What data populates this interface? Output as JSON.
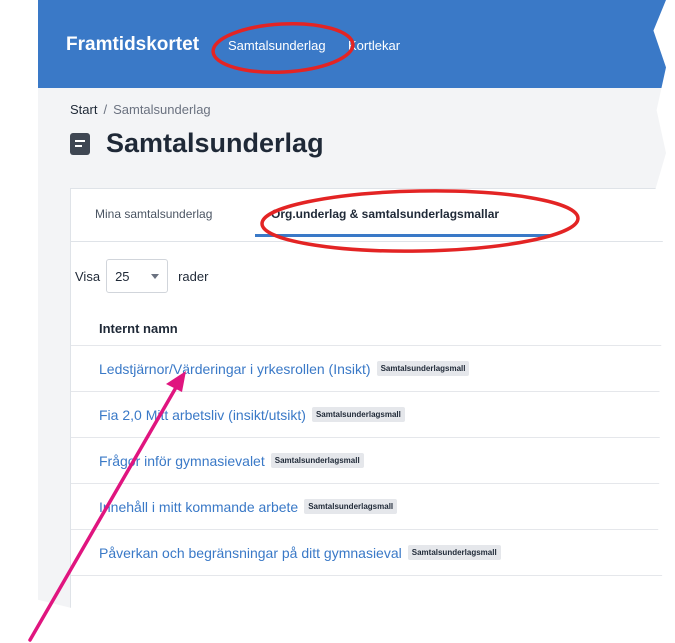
{
  "header": {
    "brand": "Framtidskortet",
    "nav": [
      "Samtalsunderlag",
      "Kortlekar"
    ]
  },
  "breadcrumb": {
    "start": "Start",
    "separator": "/",
    "current": "Samtalsunderlag"
  },
  "page_title": "Samtalsunderlag",
  "tabs": [
    {
      "label": "Mina samtalsunderlag"
    },
    {
      "label": "Org.underlag & samtalsunderlagsmallar"
    }
  ],
  "page_size": {
    "show_label": "Visa",
    "selected": "25",
    "suffix_label": "rader"
  },
  "table": {
    "column_header": "Internt namn",
    "rows": [
      {
        "name": "Ledstjärnor/Värderingar i yrkesrollen (Insikt)",
        "badge": "Samtalsunderlagsmall"
      },
      {
        "name": "Fia 2,0 Mitt arbetsliv (insikt/utsikt)",
        "badge": "Samtalsunderlagsmall"
      },
      {
        "name": "Frågor inför gymnasievalet",
        "badge": "Samtalsunderlagsmall"
      },
      {
        "name": "Innehåll i mitt kommande arbete",
        "badge": "Samtalsunderlagsmall"
      },
      {
        "name": "Påverkan och begränsningar på ditt gymnasieval",
        "badge": "Samtalsunderlagsmall"
      }
    ]
  },
  "colors": {
    "brand_blue": "#3a79c7",
    "annotation_red": "#e32424",
    "arrow_magenta": "#e0157f"
  }
}
